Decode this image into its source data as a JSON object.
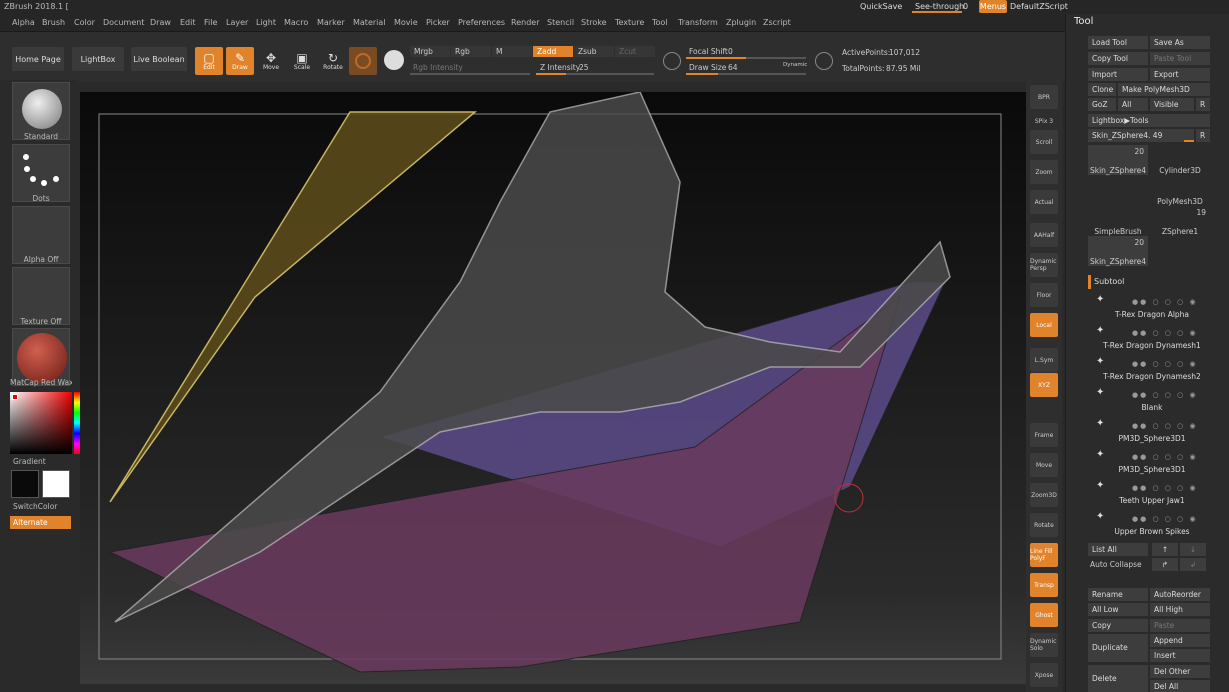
{
  "app": {
    "title": "ZBrush 2018.1 [",
    "quicksave": "QuickSave",
    "see_through_label": "See-through",
    "see_through_value": "0",
    "menus_label": "Menus",
    "script_label": "DefaultZScript"
  },
  "menus": [
    "Alpha",
    "Brush",
    "Color",
    "Document",
    "Draw",
    "Edit",
    "File",
    "Layer",
    "Light",
    "Macro",
    "Marker",
    "Material",
    "Movie",
    "Picker",
    "Preferences",
    "Render",
    "Stencil",
    "Stroke",
    "Texture",
    "Tool",
    "Transform",
    "Zplugin",
    "Zscript"
  ],
  "shelf": {
    "home_page": "Home Page",
    "lightbox": "LightBox",
    "live_boolean": "Live Boolean",
    "tools": [
      {
        "label": "Edit",
        "icon": "edit-icon",
        "on": true
      },
      {
        "label": "Draw",
        "icon": "draw-icon",
        "on": true
      },
      {
        "label": "Move",
        "icon": "move-icon",
        "on": false
      },
      {
        "label": "Scale",
        "icon": "scale-icon",
        "on": false
      },
      {
        "label": "Rotate",
        "icon": "rotate-icon",
        "on": false
      }
    ],
    "blend": {
      "mrgb": "Mrgb",
      "rgb": "Rgb",
      "m": "M",
      "zadd": "Zadd",
      "zsub": "Zsub",
      "zcut": "Zcut"
    },
    "rgb_intensity_label": "Rgb Intensity",
    "z_intensity_label": "Z Intensity",
    "z_intensity_value": "25",
    "focal_shift_label": "Focal Shift",
    "focal_shift_value": "0",
    "draw_size_label": "Draw Size",
    "draw_size_value": "64",
    "dynamic_label": "Dynamic",
    "active_points_label": "ActivePoints:",
    "active_points_value": "107,012",
    "total_points_label": "TotalPoints:",
    "total_points_value": "87.95 Mil"
  },
  "left_tray": {
    "brush": "Standard",
    "stroke": "Dots",
    "alpha": "Alpha Off",
    "texture": "Texture Off",
    "material": "MatCap Red Wax",
    "gradient": "Gradient",
    "switch_color": "SwitchColor",
    "alternate": "Alternate",
    "primary_color": "#0a0a0a",
    "secondary_color": "#ffffff"
  },
  "right_shelf": [
    {
      "label": "BPR",
      "on": false
    },
    {
      "label": "SPix 3",
      "on": false
    },
    {
      "label": "Scroll",
      "on": false
    },
    {
      "label": "Zoom",
      "on": false
    },
    {
      "label": "Actual",
      "on": false
    },
    {
      "label": "AAHalf",
      "on": false
    },
    {
      "label": "Dynamic Persp",
      "on": false
    },
    {
      "label": "Floor",
      "on": false
    },
    {
      "label": "Local",
      "on": true
    },
    {
      "label": "L.Sym",
      "on": false
    },
    {
      "label": "XYZ",
      "on": true
    },
    {
      "label": "Frame",
      "on": false
    },
    {
      "label": "Move",
      "on": false
    },
    {
      "label": "Zoom3D",
      "on": false
    },
    {
      "label": "Rotate",
      "on": false
    },
    {
      "label": "Line Fill PolyF",
      "on": true
    },
    {
      "label": "Transp",
      "on": true
    },
    {
      "label": "Ghost",
      "on": true
    },
    {
      "label": "Dynamic Solo",
      "on": false
    },
    {
      "label": "Xpose",
      "on": false
    }
  ],
  "tool_panel": {
    "title": "Tool",
    "load_tool": "Load Tool",
    "save_as": "Save As",
    "copy_tool": "Copy Tool",
    "paste_tool": "Paste Tool",
    "import": "Import",
    "export": "Export",
    "clone": "Clone",
    "make_polymesh": "Make PolyMesh3D",
    "goz": "GoZ",
    "all": "All",
    "visible": "Visible",
    "r": "R",
    "lightbox_tools": "Lightbox▶Tools",
    "current_tool": "Skin_ZSphere4. 49",
    "tiles": [
      {
        "label": "Skin_ZSphere4",
        "count": "20"
      },
      {
        "label": "Cylinder3D",
        "count": ""
      },
      {
        "label": "PolyMesh3D",
        "count": ""
      },
      {
        "label": "SimpleBrush",
        "count": ""
      },
      {
        "label": "ZSphere1",
        "count": "19"
      },
      {
        "label": "Skin_ZSphere4",
        "count": "20"
      }
    ],
    "subtool_header": "Subtool",
    "subtools": [
      "T-Rex Dragon Alpha",
      "T-Rex Dragon Dynamesh1",
      "T-Rex Dragon Dynamesh2",
      "Blank",
      "PM3D_Sphere3D1",
      "PM3D_Sphere3D1",
      "Teeth Upper Jaw1",
      "Upper Brown Spikes"
    ],
    "list_all": "List All",
    "auto_collapse": "Auto Collapse",
    "rename": "Rename",
    "auto_reorder": "AutoReorder",
    "all_low": "All Low",
    "all_high": "All High",
    "copy": "Copy",
    "paste": "Paste",
    "duplicate": "Duplicate",
    "append": "Append",
    "insert": "Insert",
    "delete": "Delete",
    "del_other": "Del Other",
    "del_all": "Del All"
  },
  "colors": {
    "accent": "#e0832a",
    "panel": "#2b2b2b",
    "button": "#3d3d3d"
  }
}
